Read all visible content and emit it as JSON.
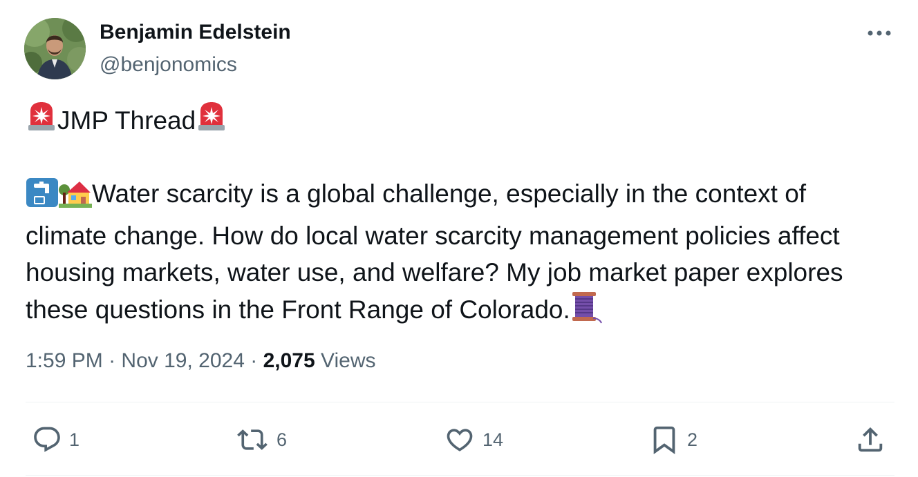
{
  "author": {
    "display_name": "Benjamin Edelstein",
    "handle": "@benjonomics"
  },
  "tweet": {
    "headline_text": "JMP Thread ",
    "headline_emoji": "rotating-light",
    "body_text_lines": [
      "Water scarcity is a global challenge, especially in the context of",
      "climate change. How do local water scarcity management policies affect",
      "housing markets, water use, and welfare? My job market paper explores",
      "these questions in the Front Range of Colorado."
    ],
    "body_emojis": [
      "potable-water",
      "house-with-garden",
      "thread"
    ]
  },
  "meta": {
    "time": "1:59 PM",
    "separator": "·",
    "date": "Nov 19, 2024",
    "views_count": "2,075",
    "views_label": "Views"
  },
  "actions": {
    "reply": {
      "icon": "reply-icon",
      "count": "1"
    },
    "retweet": {
      "icon": "retweet-icon",
      "count": "6"
    },
    "like": {
      "icon": "heart-icon",
      "count": "14"
    },
    "bookmark": {
      "icon": "bookmark-icon",
      "count": "2"
    },
    "share": {
      "icon": "share-icon"
    }
  },
  "colors": {
    "primary_text": "#0f1419",
    "secondary_text": "#536471",
    "divider": "#eff3f4"
  }
}
